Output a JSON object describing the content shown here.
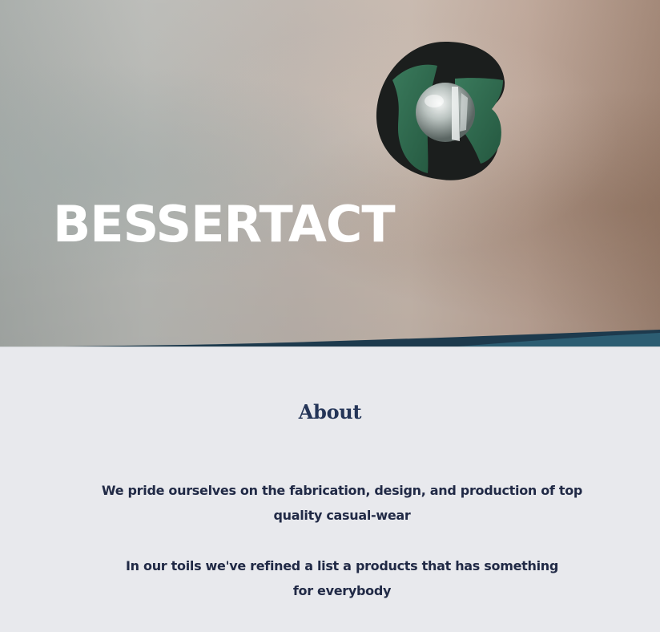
{
  "hero": {
    "title": "BESSERTACT",
    "logo_icon": "brand-logo-icon"
  },
  "about": {
    "heading": "About",
    "paragraphs": [
      "We pride ourselves on the fabrication, design, and production of top quality casual-wear",
      "In our toils we've refined a list a products that has something for everybody"
    ]
  },
  "colors": {
    "heading": "#243558",
    "body_text": "#212a46",
    "section_bg": "#e8e9ed",
    "logo_green": "#2f6b50",
    "logo_dark": "#1a1d1c"
  }
}
